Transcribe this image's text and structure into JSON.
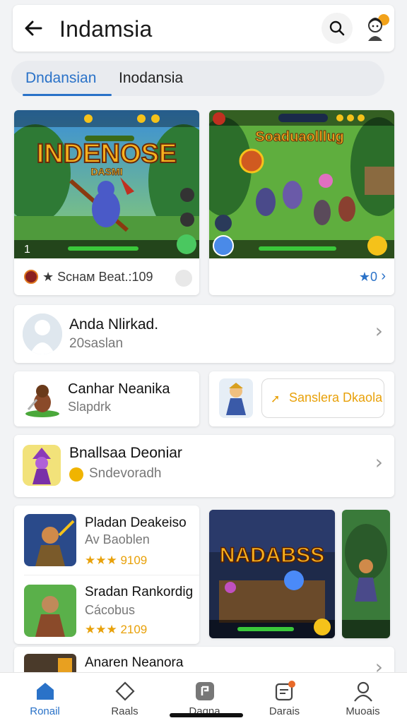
{
  "header": {
    "title": "Indamsia",
    "back_icon": "arrow-left-icon",
    "search_icon": "search-icon",
    "avatar_icon": "user-avatar-icon"
  },
  "tabs": [
    {
      "label": "Dndansian",
      "active": true
    },
    {
      "label": "Inodansia",
      "active": false
    }
  ],
  "featured": [
    {
      "art_title": "INDENOSE",
      "art_subtitle": "DASMI",
      "rank": "1",
      "footer": "★ Sснам Вeat.:109"
    },
    {
      "art_title": "Soaduaolllug",
      "footer_rating": "★0"
    }
  ],
  "rows": {
    "a": {
      "title": "Anda Nlirkad.",
      "subtitle": "20saslan"
    },
    "b": {
      "title": "Canhar Neanika",
      "subtitle": "Slapdrk"
    },
    "c": {
      "button": "Sanslera Dkaola"
    },
    "d": {
      "title": "Bnallsaa Deoniar",
      "subtitle": "Sndevoradh"
    },
    "e": [
      {
        "title": "Pladan Deakeiso",
        "subtitle": "Av Baoblen",
        "rating": "★★★ 9109"
      },
      {
        "title": "Sradan Rankordig",
        "subtitle": "Cácobus",
        "rating": "★★★ 2109"
      }
    ],
    "big_art_title": "NADABSS",
    "f": {
      "title": "Anaren Neanora"
    }
  },
  "bottom_nav": [
    {
      "label": "Ronail",
      "icon": "home-icon",
      "active": true
    },
    {
      "label": "Raals",
      "icon": "diamond-icon",
      "active": false
    },
    {
      "label": "Daqna",
      "icon": "game-icon",
      "active": false
    },
    {
      "label": "Darais",
      "icon": "inbox-icon",
      "active": false
    },
    {
      "label": "Muoais",
      "icon": "profile-icon",
      "active": false
    }
  ],
  "colors": {
    "accent": "#2a72c8",
    "star": "#f0b400",
    "button_text": "#e8a10a"
  }
}
